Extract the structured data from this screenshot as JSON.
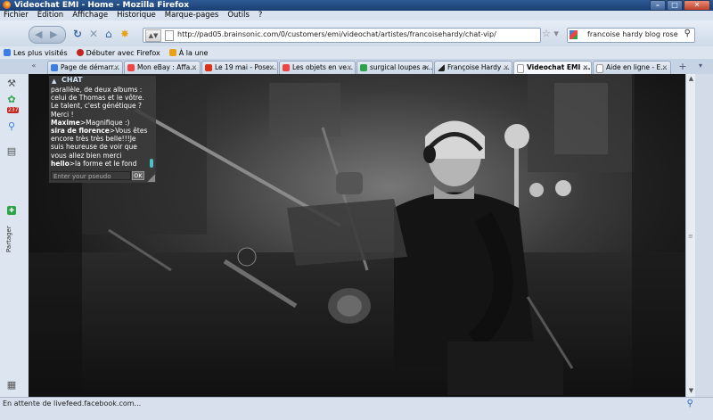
{
  "window": {
    "title": "Videochat EMI - Home - Mozilla Firefox"
  },
  "menu": [
    "Fichier",
    "Édition",
    "Affichage",
    "Historique",
    "Marque-pages",
    "Outils",
    "?"
  ],
  "navbar": {
    "url": "http://pad05.brainsonic.com/0/customers/emi/videochat/artistes/francoisehardy/chat-vip/",
    "search_value": "francoise hardy blog rose",
    "identity_label": "▲▼"
  },
  "bookmarks": [
    {
      "label": "Les plus visités",
      "color": "#3b7de0"
    },
    {
      "label": "Débuter avec Firefox",
      "color": "#c0261f"
    },
    {
      "label": "À la une",
      "color": "#e8a21a"
    }
  ],
  "tabs": [
    {
      "label": "Page de démarr...",
      "color": "#3b7de0"
    },
    {
      "label": "Mon eBay : Affa...",
      "color": "#e44"
    },
    {
      "label": "Le 19 mai - Pose...",
      "color": "#d9331a"
    },
    {
      "label": "Les objets en ve...",
      "color": "#e44"
    },
    {
      "label": "surgical loupes a...",
      "color": "#2da34a"
    },
    {
      "label": "Françoise Hardy ...",
      "color": "#222"
    },
    {
      "label": "Videochat EMI ...",
      "color": "#ffffff",
      "active": true
    },
    {
      "label": "Aide en ligne - E...",
      "color": "#ffffff"
    }
  ],
  "sidebar": {
    "badge": "237",
    "share_label": "Partager"
  },
  "chat": {
    "header": "CHAT",
    "messages": [
      {
        "nick": "",
        "text": "parallèle, de deux albums :"
      },
      {
        "nick": "",
        "text": "celui de Thomas et le vôtre."
      },
      {
        "nick": "",
        "text": "Le talent, c'est génétique ?"
      },
      {
        "nick": "",
        "text": "Merci !"
      },
      {
        "nick": "Maxime",
        "text": ">Magnifique :)"
      },
      {
        "nick": "sira de florence",
        "text": ">Vous êtes"
      },
      {
        "nick": "",
        "text": "encore très très belle!!!Je"
      },
      {
        "nick": "",
        "text": "suis heureuse de voir que"
      },
      {
        "nick": "",
        "text": "vous allez bien merci"
      },
      {
        "nick": "hello",
        "text": ">la forme et le fond"
      }
    ],
    "input_placeholder": "Enter your pseudo",
    "ok_label": "OK"
  },
  "status": {
    "text": "En attente de livefeed.facebook.com..."
  }
}
